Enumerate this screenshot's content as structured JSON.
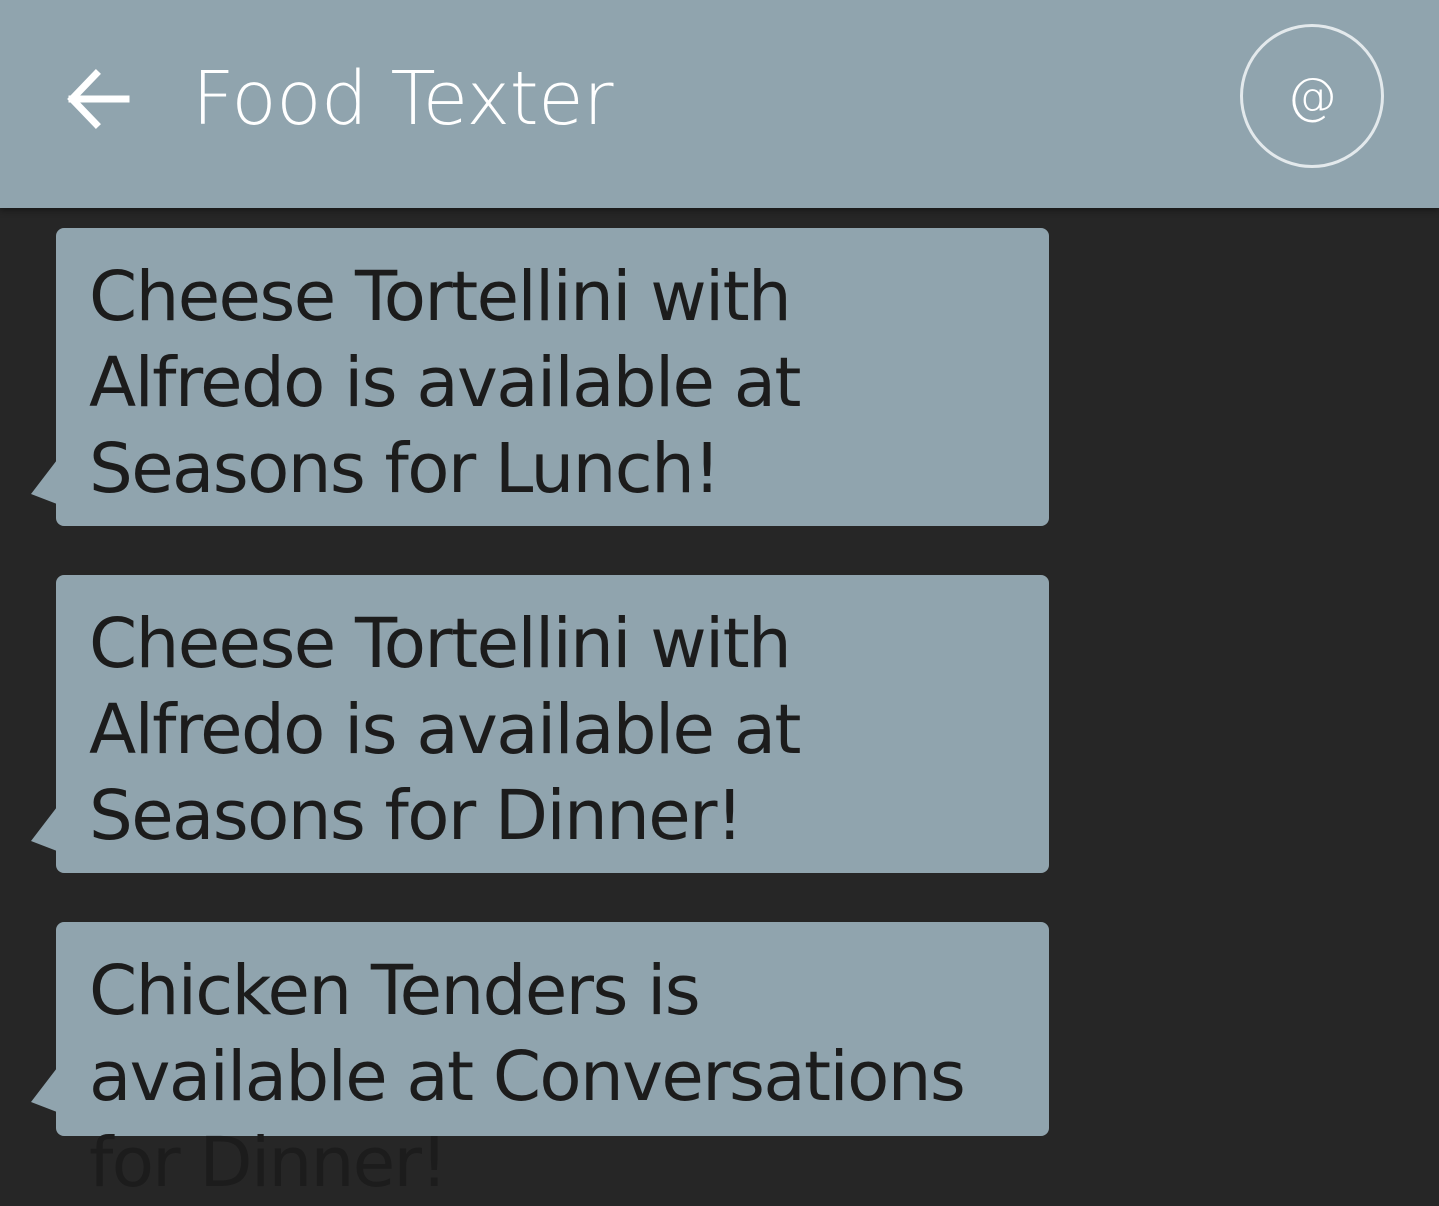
{
  "app_bar": {
    "title": "Food Texter",
    "back_icon": "arrow-left-icon",
    "action_label": "@",
    "background": "#90a4ae"
  },
  "messages": [
    {
      "text": "Cheese Tortellini with Alfredo is available at Seasons for Lunch!"
    },
    {
      "text": "Cheese Tortellini with Alfredo is available at Seasons for Dinner!"
    },
    {
      "text": "Chicken Tenders is available at Conversations for Dinner!"
    }
  ],
  "colors": {
    "background": "#262626",
    "bubble": "#90a4ae",
    "bubble_text": "#1c1c1c",
    "title_text": "#ffffff"
  }
}
